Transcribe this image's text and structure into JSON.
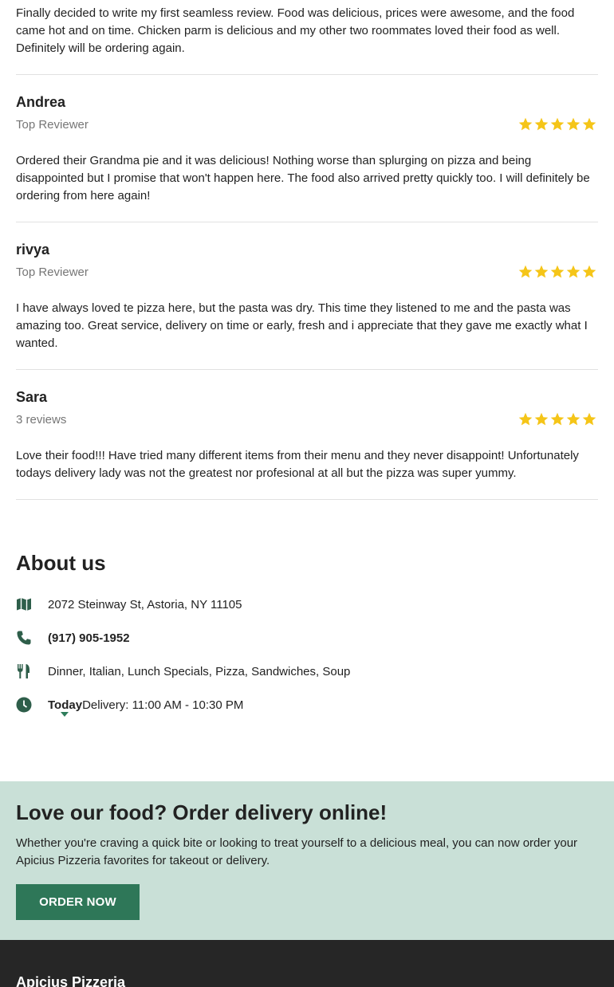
{
  "reviews": [
    {
      "text": "Finally decided to write my first seamless review. Food was delicious, prices were awesome, and the food came hot and on time. Chicken parm is delicious and my other two roommates loved their food as well. Definitely will be ordering again."
    },
    {
      "name": "Andrea",
      "subtitle": "Top Reviewer",
      "rating": 5,
      "text": "Ordered their Grandma pie and it was delicious! Nothing worse than splurging on pizza and being disappointed but I promise that won't happen here. The food also arrived pretty quickly too. I will definitely be ordering from here again!"
    },
    {
      "name": "rivya",
      "subtitle": "Top Reviewer",
      "rating": 5,
      "text": "I have always loved te pizza here, but the pasta was dry. This time they listened to me and the pasta was amazing too. Great service, delivery on time or early, fresh and i appreciate that they gave me exactly what I wanted."
    },
    {
      "name": "Sara",
      "subtitle": "3 reviews",
      "rating": 5,
      "text": "Love their food!!! Have tried many different items from their menu and they never disappoint! Unfortunately todays delivery lady was not the greatest nor profesional at all but the pizza was super yummy."
    }
  ],
  "about": {
    "heading": "About us",
    "address": "2072 Steinway St, Astoria, NY 11105",
    "phone": "(917) 905-1952",
    "cuisines": "Dinner, Italian, Lunch Specials, Pizza, Sandwiches, Soup",
    "hours_day": "Today",
    "hours_text": "Delivery: 11:00 AM - 10:30 PM"
  },
  "cta": {
    "heading": "Love our food? Order delivery online!",
    "text": "Whether you're craving a quick bite or looking to treat yourself to a delicious meal, you can now order your Apicius Pizzeria favorites for takeout or delivery.",
    "button": "ORDER NOW"
  },
  "footer": {
    "title": "Apicius Pizzeria"
  },
  "colors": {
    "star": "#f5c518",
    "accent": "#2e7758",
    "cta_bg": "#c9e0d7",
    "footer_bg": "#262626"
  }
}
